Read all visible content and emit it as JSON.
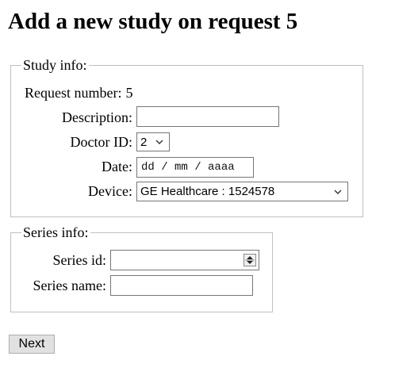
{
  "page": {
    "title": "Add a new study on request 5"
  },
  "study_info": {
    "legend": "Study info:",
    "request_number_label": "Request number:",
    "request_number_value": "5",
    "description_label": "Description:",
    "description_value": "",
    "doctor_id_label": "Doctor ID:",
    "doctor_id_value": "2",
    "date_label": "Date:",
    "date_placeholder": "dd / mm / aaaa",
    "device_label": "Device:",
    "device_value": "GE Healthcare : 1524578"
  },
  "series_info": {
    "legend": "Series info:",
    "series_id_label": "Series id:",
    "series_id_value": "",
    "series_name_label": "Series name:",
    "series_name_value": ""
  },
  "actions": {
    "next_label": "Next"
  }
}
